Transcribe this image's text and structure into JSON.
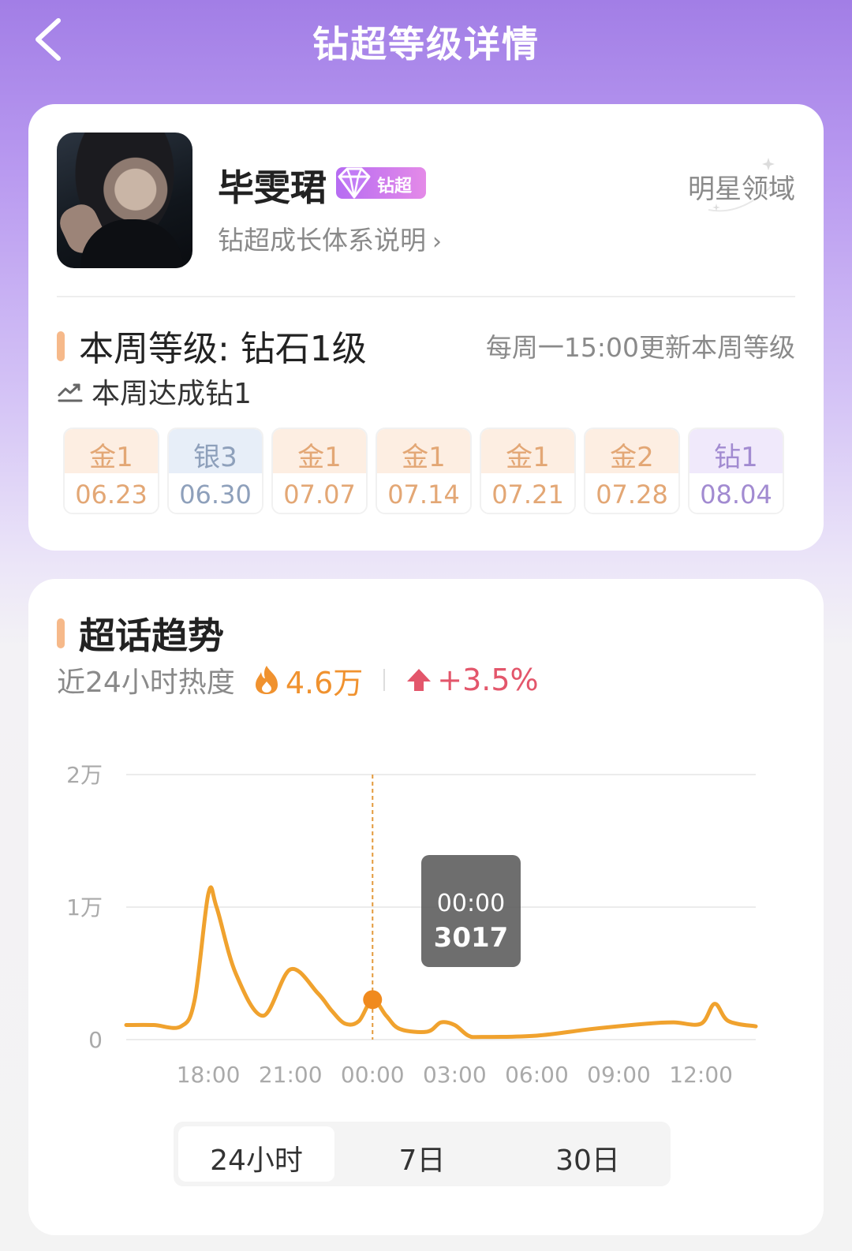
{
  "header": {
    "title": "钻超等级详情"
  },
  "profile": {
    "name": "毕雯珺",
    "badge": "钻超",
    "system_link": "钻超成长体系说明",
    "system_link_chevron": "›",
    "domain_link": "明星领域"
  },
  "level": {
    "title": "本周等级: 钻石1级",
    "update_note": "每周一15:00更新本周等级",
    "achievement": "本周达成钻1",
    "weeks": [
      {
        "level": "金1",
        "date": "06.23",
        "tier": "gold"
      },
      {
        "level": "银3",
        "date": "06.30",
        "tier": "silver"
      },
      {
        "level": "金1",
        "date": "07.07",
        "tier": "gold"
      },
      {
        "level": "金1",
        "date": "07.14",
        "tier": "gold"
      },
      {
        "level": "金1",
        "date": "07.21",
        "tier": "gold"
      },
      {
        "level": "金2",
        "date": "07.28",
        "tier": "gold"
      },
      {
        "level": "钻1",
        "date": "08.04",
        "tier": "diamond"
      }
    ]
  },
  "trend": {
    "title": "超话趋势",
    "heat_label": "近24小时热度",
    "heat_value": "4.6万",
    "heat_change": "+3.5%",
    "tooltip": {
      "time": "00:00",
      "value": "3017"
    },
    "tabs": [
      {
        "label": "24小时",
        "active": true
      },
      {
        "label": "7日",
        "active": false
      },
      {
        "label": "30日",
        "active": false
      }
    ]
  },
  "colors": {
    "line": "#f0a22e",
    "gold_text": "#e3a775",
    "silver_text": "#8ea0bb",
    "diamond_text": "#a28bd1",
    "heat": "#f0922f",
    "change": "#e3566b"
  },
  "chart_data": {
    "type": "line",
    "ytick_labels": [
      "2万",
      "1万",
      "0"
    ],
    "yticks": [
      20000,
      10000,
      0
    ],
    "ylim": [
      0,
      20000
    ],
    "xtick_labels": [
      "18:00",
      "21:00",
      "00:00",
      "03:00",
      "06:00",
      "09:00",
      "12:00"
    ],
    "xticks": [
      3,
      6,
      9,
      12,
      15,
      18,
      21
    ],
    "xlim": [
      0,
      23
    ],
    "grid": true,
    "highlight": {
      "x": 9,
      "label": "00:00",
      "value": 3017
    },
    "series": [
      {
        "x": [
          0,
          1,
          2,
          2.5,
          3,
          3.3,
          4,
          5,
          6,
          7,
          7.5,
          8,
          8.5,
          9,
          9.5,
          10,
          11,
          11.5,
          12,
          12.5,
          13,
          15,
          17,
          19,
          20,
          21,
          21.5,
          22,
          23
        ],
        "values": [
          1100,
          1100,
          1000,
          3000,
          11000,
          10000,
          5000,
          1800,
          5300,
          3500,
          2200,
          1200,
          1400,
          3017,
          1800,
          800,
          600,
          1300,
          1100,
          300,
          200,
          300,
          800,
          1200,
          1300,
          1200,
          2700,
          1400,
          1000
        ]
      }
    ]
  }
}
